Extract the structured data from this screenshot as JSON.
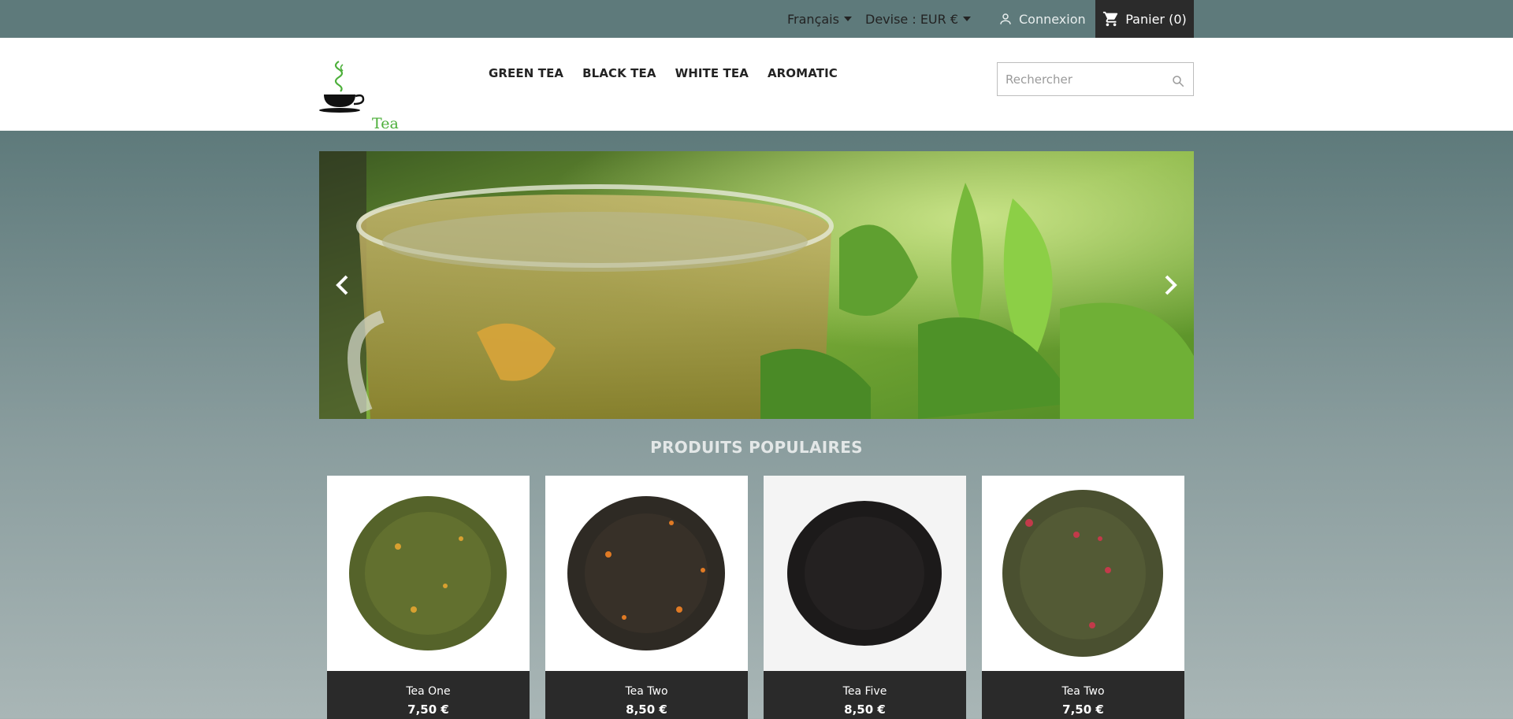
{
  "topbar": {
    "language": "Français",
    "currency": "Devise : EUR €",
    "login": "Connexion",
    "cart": "Panier (0)"
  },
  "header": {
    "logo_text": "Tea",
    "menu": [
      "GREEN TEA",
      "BLACK TEA",
      "WHITE TEA",
      "AROMATIC"
    ],
    "search_placeholder": "Rechercher"
  },
  "slider": {
    "icons": [
      "chevron-left-icon",
      "chevron-right-icon"
    ]
  },
  "products_section": {
    "title": "PRODUITS POPULAIRES",
    "items": [
      {
        "name": "Tea One",
        "price": "7,50 €",
        "leaf_color": "#55632a"
      },
      {
        "name": "Tea Two",
        "price": "8,50 €",
        "leaf_color": "#2e2a24"
      },
      {
        "name": "Tea Five",
        "price": "8,50 €",
        "leaf_color": "#1c1a1a"
      },
      {
        "name": "Tea Two",
        "price": "7,50 €",
        "leaf_color": "#4a5030"
      }
    ]
  },
  "colors": {
    "topbar_bg": "#5e7a7b",
    "cart_bg": "#2b2b2b",
    "logo_green": "#4caf3a",
    "card_footer": "#2a2a2a"
  }
}
